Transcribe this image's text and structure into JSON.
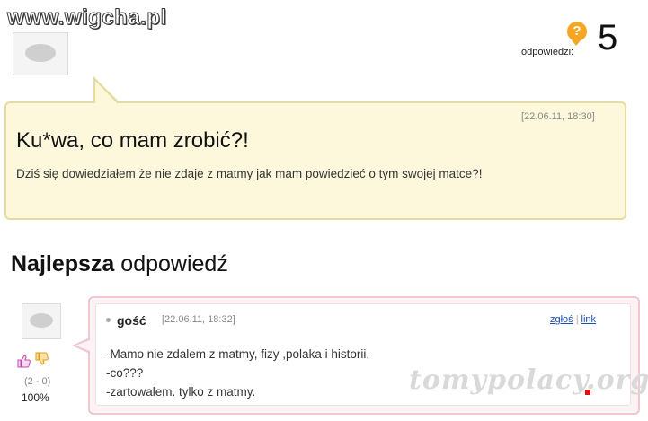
{
  "watermark_top": "www.wigcha.pl",
  "watermark_bottom": "tomypolacy.org",
  "question": {
    "answers_label": "odpowiedzi:",
    "answers_count": "5",
    "date": "[22.06.11, 18:30]",
    "title": "Ku*wa, co mam zrobić?!",
    "body": "Dziś się dowiedziałem że nie zdaje z matmy jak mam powiedzieć o tym swojej matce?!"
  },
  "best_answer": {
    "heading_bold": "Najlepsza",
    "heading_rest": "odpowiedź",
    "author": "gość",
    "date": "[22.06.11, 18:32]",
    "report_link": "zgłoś",
    "link_label": "link",
    "lines": [
      "-Mamo nie zdalem z matmy, fizy ,polaka i historii.",
      "-co???",
      "-zartowalem. tylko z matmy."
    ],
    "votes": "(2 - 0)",
    "percent": "100%"
  },
  "icons": {
    "question_icon": "question-bubble-icon",
    "thumb_up": "thumb-up-icon",
    "thumb_down": "thumb-down-icon"
  },
  "colors": {
    "question_bg": "#fdf7dc",
    "answer_bg": "#fdf2f4",
    "accent_orange": "#f5a623",
    "link_blue": "#1a4fb8"
  }
}
